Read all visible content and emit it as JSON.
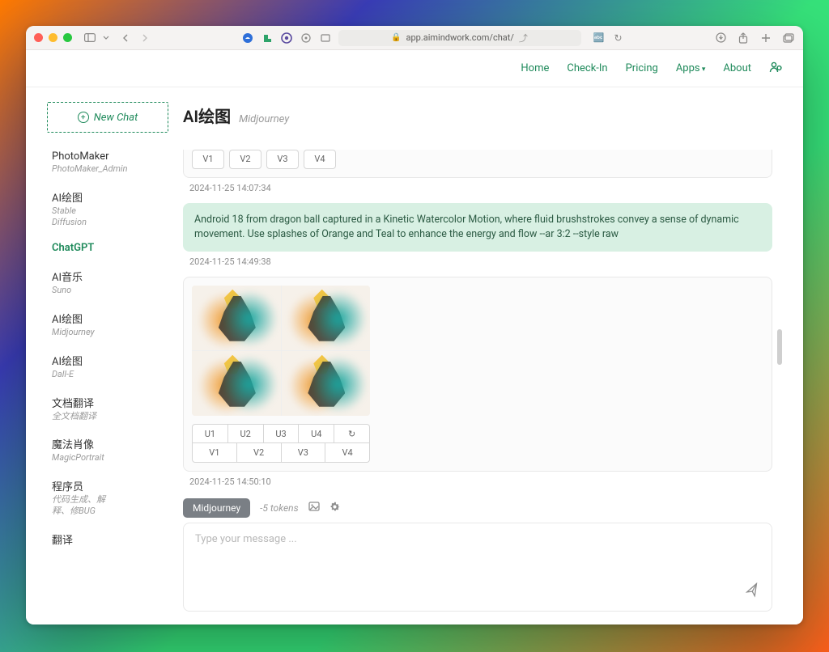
{
  "browser": {
    "url": "app.aimindwork.com/chat/"
  },
  "nav": {
    "items": [
      "Home",
      "Check-In",
      "Pricing",
      "Apps",
      "About"
    ]
  },
  "sidebar": {
    "newChat": "New Chat",
    "items": [
      {
        "title": "PhotoMaker",
        "sub": "PhotoMaker_Admin",
        "active": false
      },
      {
        "title": "AI绘图",
        "sub": "Stable\nDiffusion",
        "active": false
      },
      {
        "title": "ChatGPT",
        "sub": "",
        "active": true
      },
      {
        "title": "AI音乐",
        "sub": "Suno",
        "active": false
      },
      {
        "title": "AI绘图",
        "sub": "Midjourney",
        "active": false
      },
      {
        "title": "AI绘图",
        "sub": "Dall-E",
        "active": false
      },
      {
        "title": "文档翻译",
        "sub": "全文档翻译",
        "active": false
      },
      {
        "title": "魔法肖像",
        "sub": "MagicPortrait",
        "active": false
      },
      {
        "title": "程序员",
        "sub": "代码生成、解\n释、修BUG",
        "active": false
      },
      {
        "title": "翻译",
        "sub": "",
        "active": false
      }
    ]
  },
  "header": {
    "title": "AI绘图",
    "subtitle": "Midjourney"
  },
  "messages": {
    "prevV": [
      "V1",
      "V2",
      "V3",
      "V4"
    ],
    "ts1": "2024-11-25 14:07:34",
    "userPrompt": "Android 18 from dragon ball captured in a Kinetic Watercolor Motion, where fluid brushstrokes convey a sense of dynamic movement. Use splashes of Orange and Teal to enhance the energy and flow --ar 3:2 --style raw",
    "ts2": "2024-11-25 14:49:38",
    "uRow": [
      "U1",
      "U2",
      "U3",
      "U4"
    ],
    "vRow": [
      "V1",
      "V2",
      "V3",
      "V4"
    ],
    "refreshIcon": "↻",
    "ts3": "2024-11-25 14:50:10"
  },
  "composer": {
    "model": "Midjourney",
    "tokens": "-5 tokens",
    "placeholder": "Type your message ..."
  }
}
